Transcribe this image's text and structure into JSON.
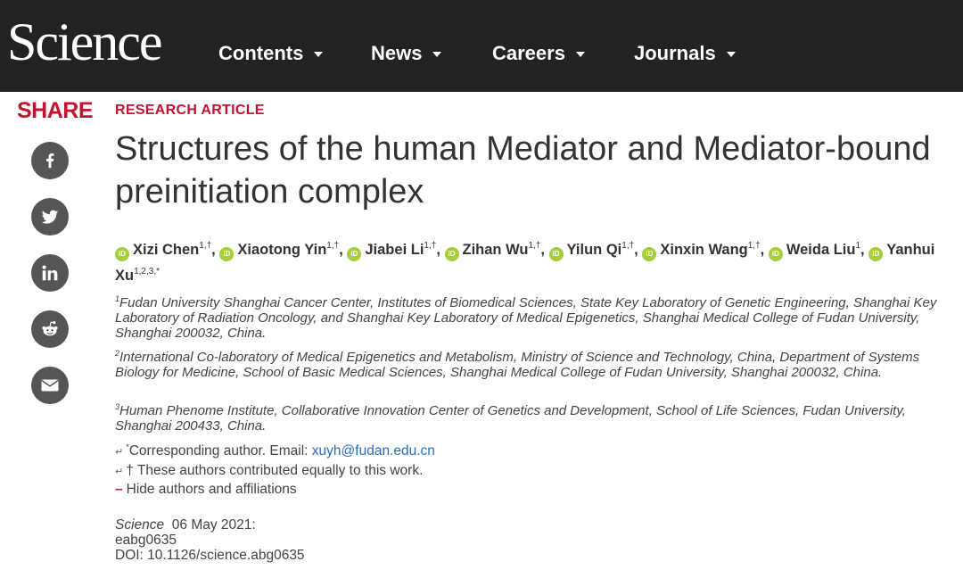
{
  "header": {
    "logo": "Science",
    "nav": [
      {
        "label": "Contents"
      },
      {
        "label": "News"
      },
      {
        "label": "Careers"
      },
      {
        "label": "Journals"
      }
    ]
  },
  "share": {
    "label": "SHARE",
    "icons": [
      "facebook-icon",
      "twitter-icon",
      "linkedin-icon",
      "reddit-icon",
      "email-icon"
    ]
  },
  "article": {
    "type": "RESEARCH ARTICLE",
    "title": "Structures of the human Mediator and Mediator-bound preinitiation complex",
    "orcid_glyph": "iD",
    "authors": [
      {
        "name": "Xizi Chen",
        "sup": "1,†",
        "sep": ","
      },
      {
        "name": "Xiaotong Yin",
        "sup": "1,†",
        "sep": ","
      },
      {
        "name": "Jiabei Li",
        "sup": "1,†",
        "sep": ","
      },
      {
        "name": "Zihan Wu",
        "sup": "1,†",
        "sep": ","
      },
      {
        "name": "Yilun Qi",
        "sup": "1,†",
        "sep": ","
      },
      {
        "name": "Xinxin Wang",
        "sup": "1,†",
        "sep": ","
      },
      {
        "name": "Weida Liu",
        "sup": "1",
        "sep": ","
      },
      {
        "name": "Yanhui Xu",
        "sup": "1,2,3,*",
        "sep": ""
      }
    ],
    "affiliations": [
      {
        "num": "1",
        "text": "Fudan University Shanghai Cancer Center, Institutes of Biomedical Sciences, State Key Laboratory of Genetic Engineering, Shanghai Key Laboratory of Radiation Oncology, and Shanghai Key Laboratory of Medical Epigenetics, Shanghai Medical College of Fudan University, Shanghai 200032, China."
      },
      {
        "num": "2",
        "text": "International Co-laboratory of Medical Epigenetics and Metabolism, Ministry of Science and Technology, China, Department of Systems Biology for Medicine, School of Basic Medical Sciences, Shanghai Medical College of Fudan University, Shanghai 200032, China."
      },
      {
        "num": "3",
        "text": "Human Phenome Institute, Collaborative Innovation Center of Genetics and Development, School of Life Sciences, Fudan University, Shanghai 200433, China."
      }
    ],
    "corresponding": {
      "arrow": "↵",
      "marker": "*",
      "text": "Corresponding author. Email: ",
      "email": "xuyh@fudan.edu.cn"
    },
    "equal_contribution": {
      "arrow": "↵",
      "text": "† These authors contributed equally to this work."
    },
    "hide": {
      "dash": "–",
      "label": "Hide authors and affiliations"
    },
    "citation": {
      "journal": "Science",
      "date": "06 May 2021:",
      "id": "eabg0635",
      "doi": "DOI: 10.1126/science.abg0635"
    }
  }
}
